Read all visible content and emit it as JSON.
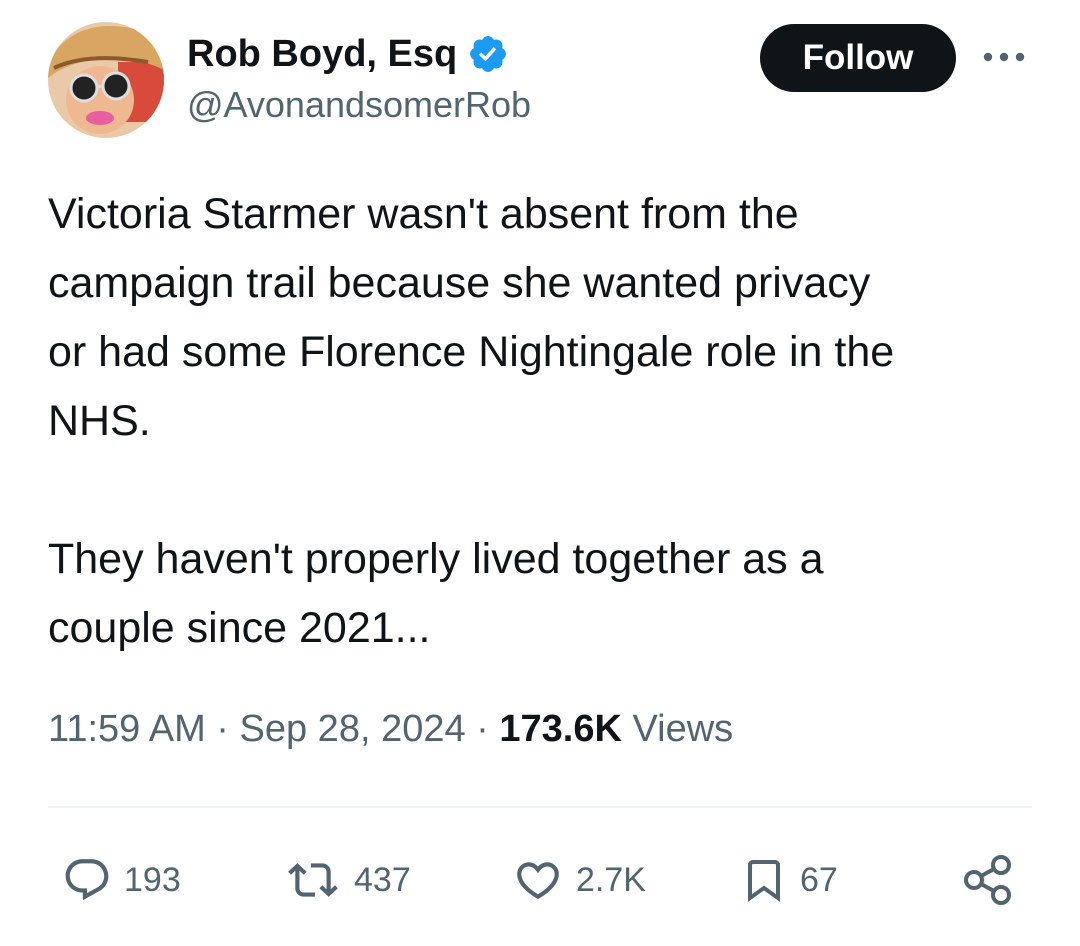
{
  "author": {
    "display_name": "Rob Boyd, Esq",
    "handle": "@AvonandsomerRob",
    "verified_icon": "verified-badge-icon",
    "badge_color": "#1d9bf0"
  },
  "follow_button": {
    "label": "Follow"
  },
  "tweet": {
    "paragraphs": [
      "Victoria Starmer wasn't absent from the\ncampaign trail because she wanted privacy\nor had some Florence Nightingale role in the\nNHS.",
      "They haven't properly lived together as a\ncouple since 2021..."
    ]
  },
  "meta": {
    "time": "11:59 AM",
    "separator": "·",
    "date": "Sep 28, 2024",
    "views_count": "173.6K",
    "views_label": "Views"
  },
  "actions": {
    "replies": "193",
    "reposts": "437",
    "likes": "2.7K",
    "bookmarks": "67"
  },
  "colors": {
    "text_primary": "#0f1419",
    "text_secondary": "#536471",
    "divider": "#eff3f4"
  }
}
